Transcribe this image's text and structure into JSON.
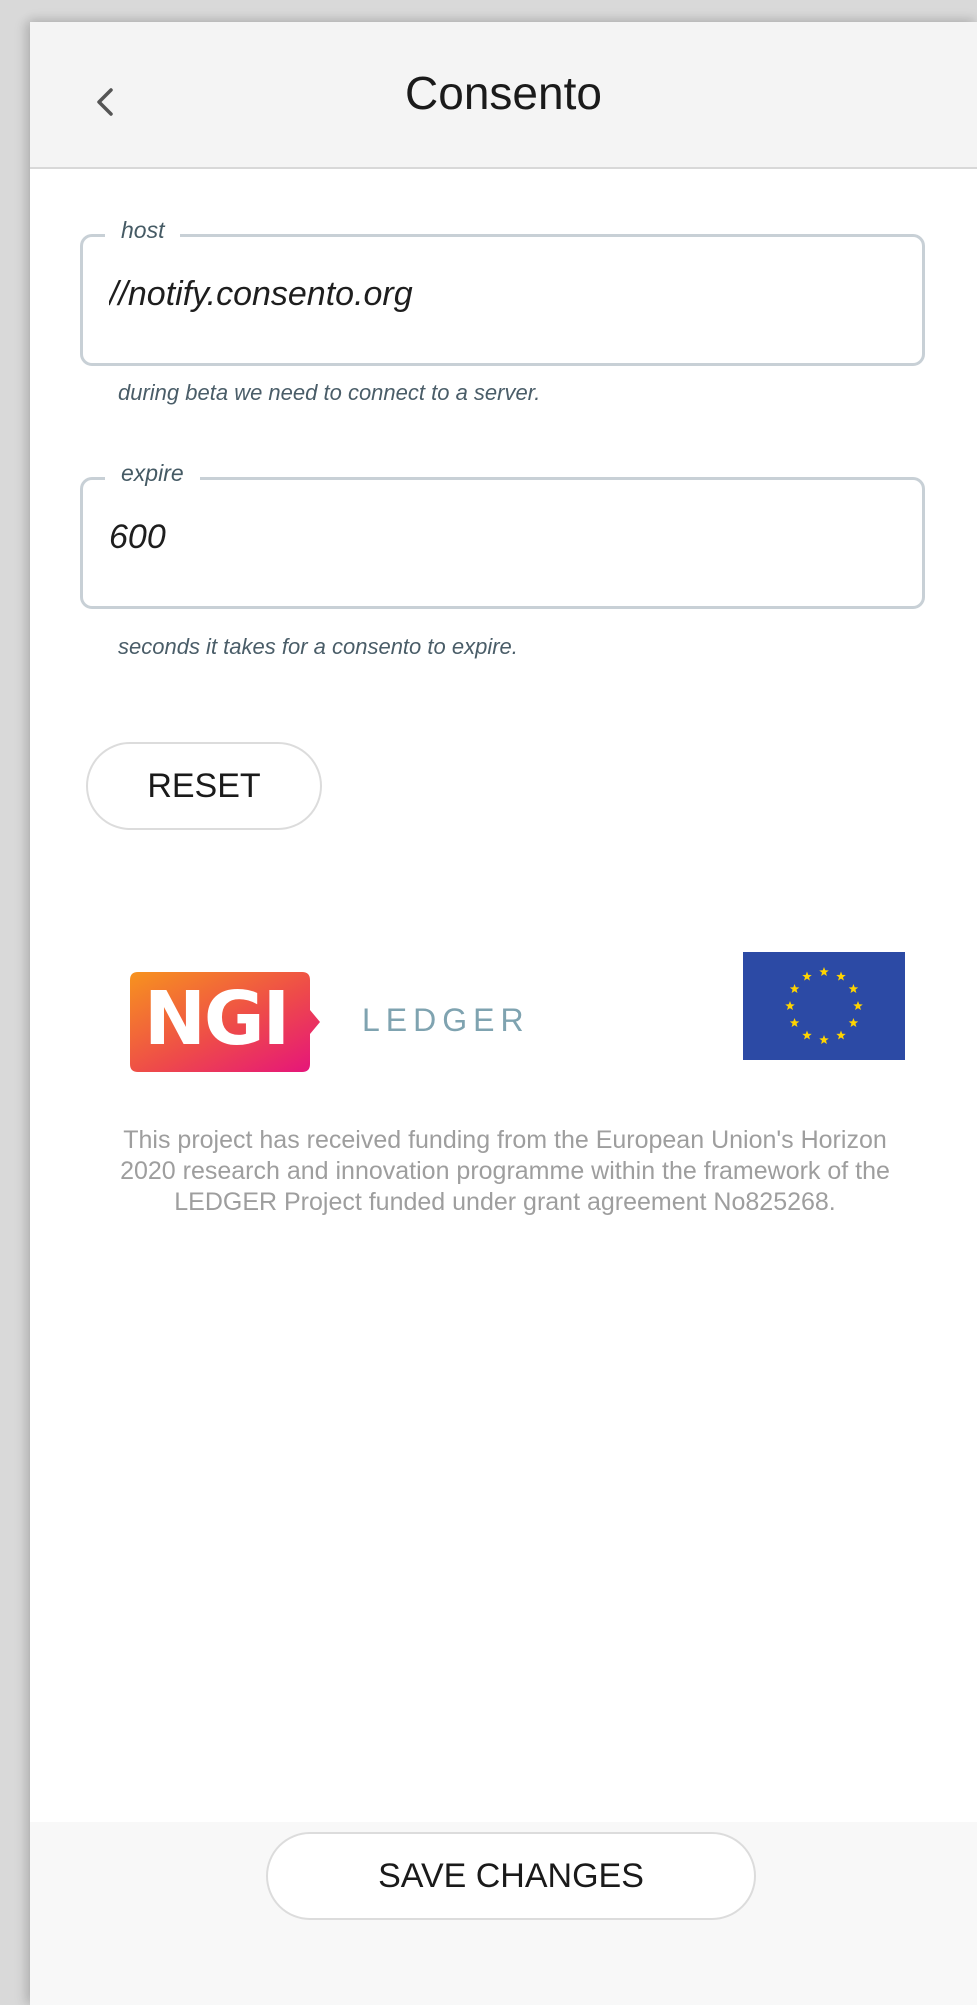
{
  "header": {
    "title": "Consento",
    "back_icon": "chevron-left-icon"
  },
  "settings": {
    "host": {
      "label": "host",
      "value": "//notify.consento.org",
      "helper": "during beta we need to connect to a server."
    },
    "expire": {
      "label": "expire",
      "value": "600",
      "helper": "seconds it takes for a consento to expire."
    },
    "reset_label": "RESET"
  },
  "footer": {
    "ngi_logo_text": "NGI",
    "ledger_logo_text": "LEDGER",
    "eu_flag_icon": "eu-flag-icon",
    "funding_text": "This project has received funding from the European Union's Horizon 2020 research and innovation programme within the framework of the LEDGER Project funded under grant agreement No825268."
  },
  "actions": {
    "save_label": "SAVE CHANGES"
  },
  "colors": {
    "header_bg": "#f4f4f4",
    "field_border": "#c8d0d6",
    "helper_text": "#4a5d68",
    "funding_text": "#9e9e9e",
    "eu_blue": "#2c4aa5",
    "eu_star": "#ffd400",
    "ngi_gradient_start": "#f7931e",
    "ngi_gradient_end": "#e5127d"
  }
}
